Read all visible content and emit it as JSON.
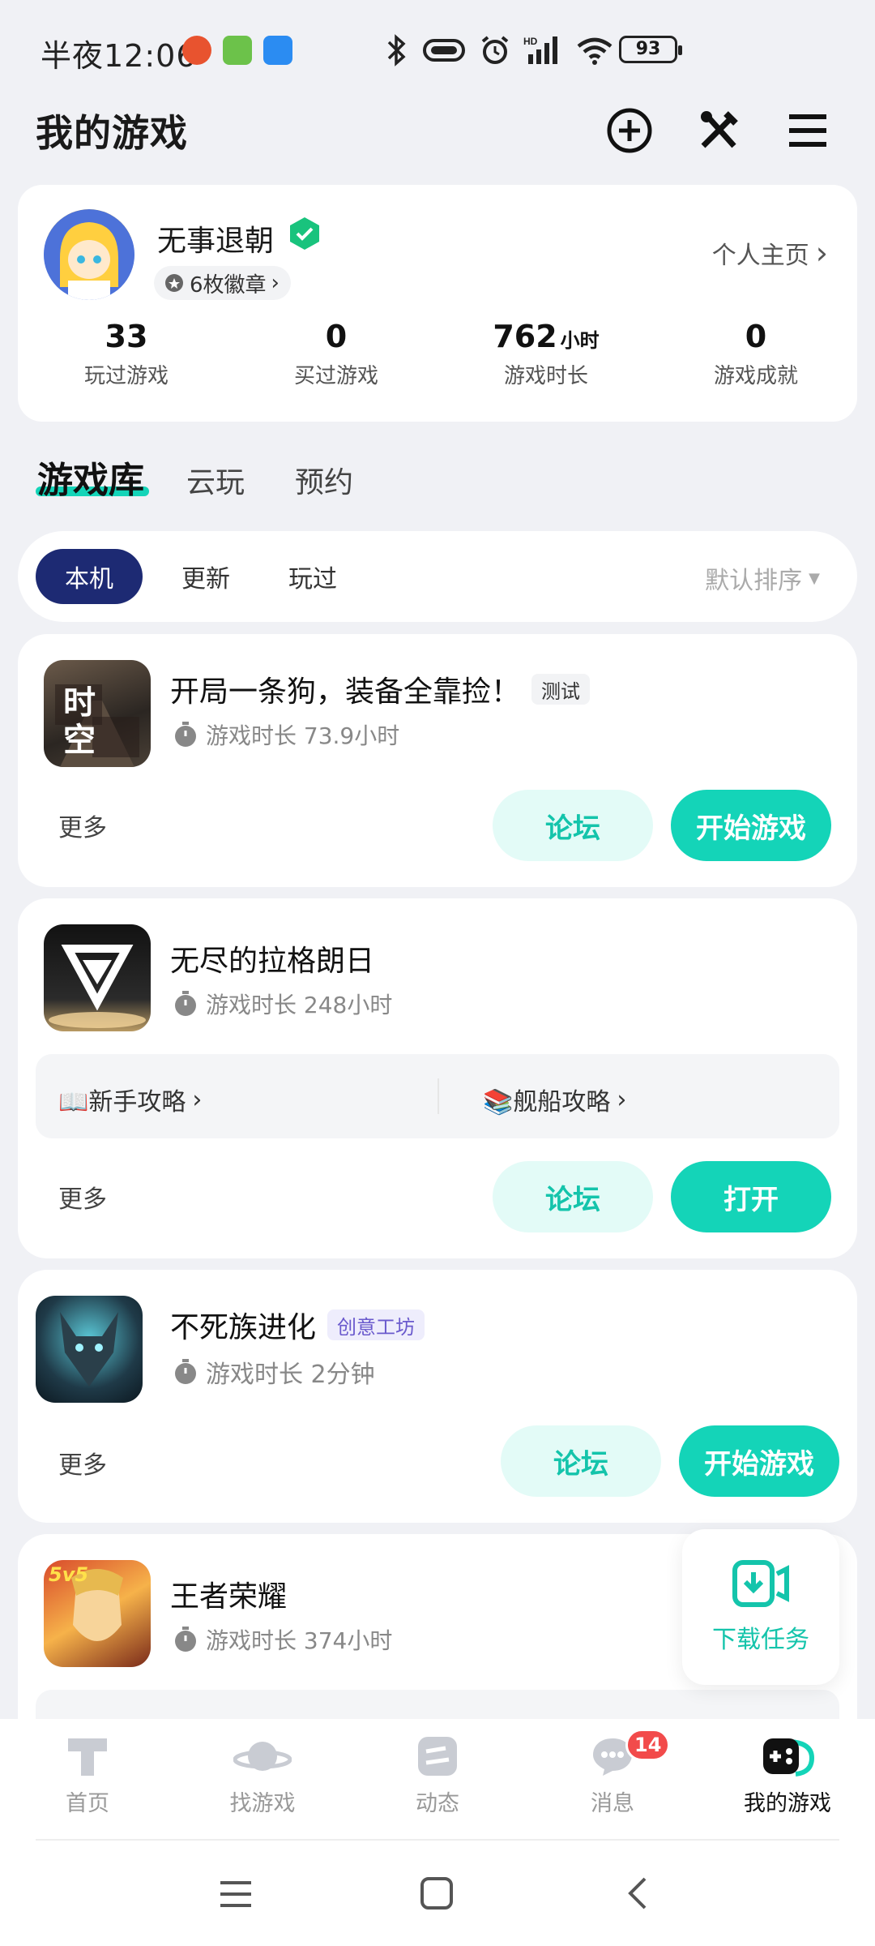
{
  "status_bar": {
    "time": "半夜12:06",
    "battery": "93"
  },
  "header": {
    "title": "我的游戏"
  },
  "profile": {
    "username": "无事退朝",
    "badge_label": "6枚徽章",
    "homepage_label": "个人主页",
    "stats": [
      {
        "value": "33",
        "unit": "",
        "label": "玩过游戏"
      },
      {
        "value": "0",
        "unit": "",
        "label": "买过游戏"
      },
      {
        "value": "762",
        "unit": "小时",
        "label": "游戏时长"
      },
      {
        "value": "0",
        "unit": "",
        "label": "游戏成就"
      }
    ]
  },
  "main_tabs": [
    "游戏库",
    "云玩",
    "预约"
  ],
  "filters": {
    "chips": [
      "本机",
      "更新",
      "玩过"
    ],
    "sort_label": "默认排序"
  },
  "games": [
    {
      "name": "开局一条狗，装备全靠捡！",
      "tag": "测试",
      "playtime": "游戏时长 73.9小时",
      "more": "更多",
      "forum": "论坛",
      "action": "开始游戏",
      "icon_text": "时 空"
    },
    {
      "name": "无尽的拉格朗日",
      "tag": "",
      "playtime": "游戏时长 248小时",
      "more": "更多",
      "forum": "论坛",
      "action": "打开",
      "guides": [
        "📖新手攻略",
        "📚舰船攻略"
      ]
    },
    {
      "name": "不死族进化",
      "tag": "创意工坊",
      "playtime": "游戏时长 2分钟",
      "more": "更多",
      "forum": "论坛",
      "action": "开始游戏"
    },
    {
      "name": "王者荣耀",
      "tag": "",
      "playtime": "游戏时长 374小时",
      "icon_text": "5v5"
    }
  ],
  "download_float": {
    "label": "下载任务"
  },
  "bottom_nav": {
    "items": [
      "首页",
      "找游戏",
      "动态",
      "消息",
      "我的游戏"
    ],
    "message_badge": "14"
  },
  "colors": {
    "accent": "#14d4b8",
    "chip_active": "#1d2a73",
    "badge": "#f24b4b"
  }
}
